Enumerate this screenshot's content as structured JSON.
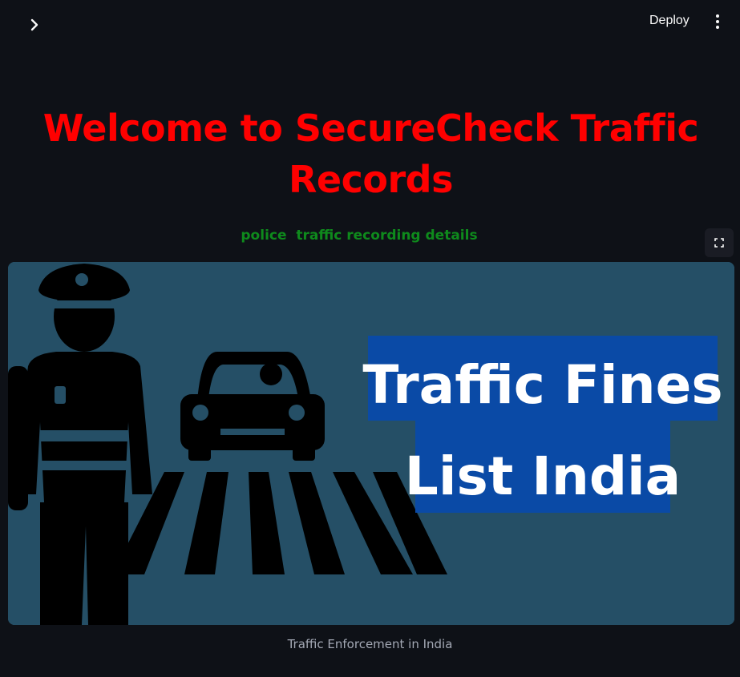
{
  "header": {
    "sidebar_toggle_icon": "chevron-right-icon",
    "deploy_label": "Deploy",
    "menu_icon": "more-vertical-icon"
  },
  "main": {
    "title": "Welcome to SecureCheck Traffic Records",
    "subtitle": "police  traffic recording details",
    "fullscreen_icon": "fullscreen-icon",
    "image": {
      "headline_line1": "Traffic Fines",
      "headline_line2": "List India",
      "background_color": "#254f66",
      "banner_color": "#0a4aa6"
    },
    "caption": "Traffic Enforcement in India"
  },
  "colors": {
    "app_background": "#0e1117",
    "title_color": "#ff0000",
    "subtitle_color": "#0e8a1c"
  }
}
